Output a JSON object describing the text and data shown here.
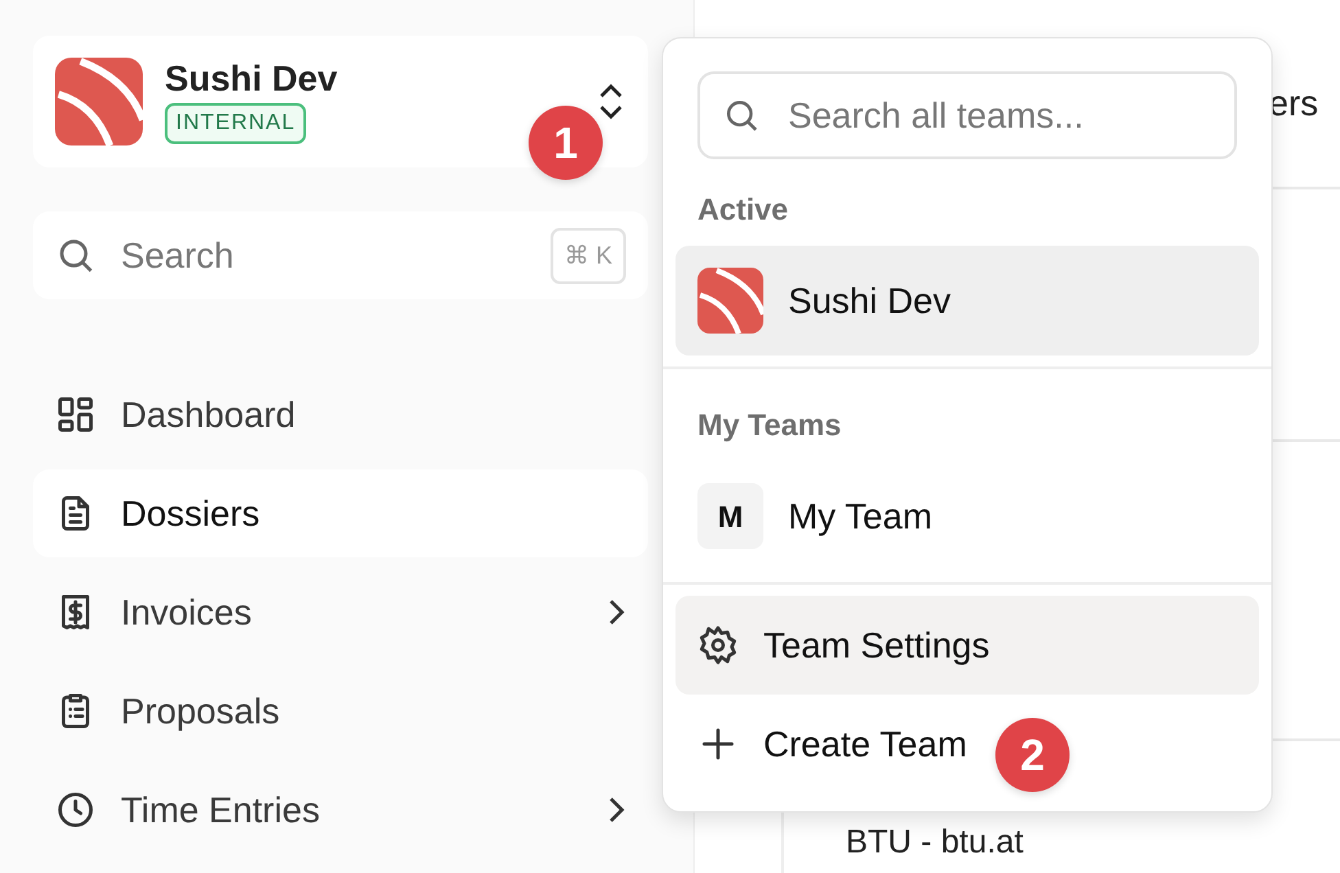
{
  "team": {
    "name": "Sushi Dev",
    "tag": "INTERNAL"
  },
  "search": {
    "placeholder": "Search",
    "shortcut": "⌘ K"
  },
  "nav": [
    {
      "label": "Dashboard",
      "selected": false,
      "has_submenu": false
    },
    {
      "label": "Dossiers",
      "selected": true,
      "has_submenu": false
    },
    {
      "label": "Invoices",
      "selected": false,
      "has_submenu": true
    },
    {
      "label": "Proposals",
      "selected": false,
      "has_submenu": false
    },
    {
      "label": "Time Entries",
      "selected": false,
      "has_submenu": true
    }
  ],
  "main": {
    "header_text": "ers",
    "row_text": "BTU - btu.at"
  },
  "team_menu": {
    "search": {
      "placeholder": "Search all teams..."
    },
    "sections": [
      {
        "heading": "Active",
        "teams": [
          {
            "name": "Sushi Dev",
            "kind": "logo",
            "highlighted": true
          }
        ]
      },
      {
        "heading": "My Teams",
        "teams": [
          {
            "name": "My Team",
            "kind": "initial",
            "initial": "M",
            "highlighted": false
          }
        ]
      }
    ],
    "actions": [
      {
        "label": "Team Settings",
        "highlighted": true
      },
      {
        "label": "Create Team",
        "highlighted": false
      }
    ]
  },
  "markers": [
    {
      "label": "1"
    },
    {
      "label": "2"
    }
  ]
}
